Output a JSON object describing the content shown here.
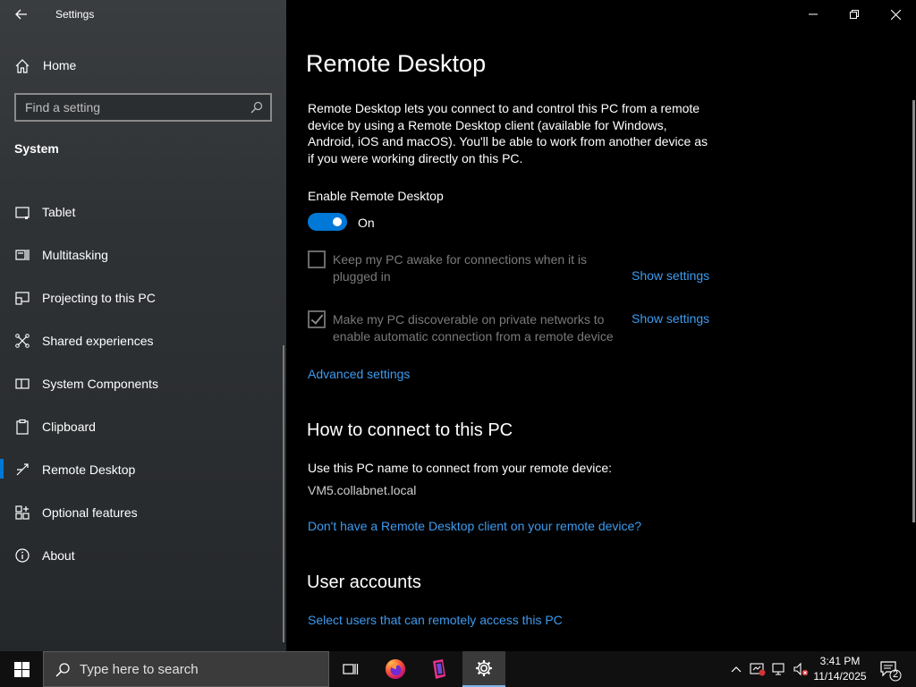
{
  "window": {
    "app_title": "Settings"
  },
  "sidebar": {
    "home_label": "Home",
    "search_placeholder": "Find a setting",
    "section_title": "System",
    "items": [
      {
        "label": "Tablet",
        "icon": "tablet-icon"
      },
      {
        "label": "Multitasking",
        "icon": "multitasking-icon"
      },
      {
        "label": "Projecting to this PC",
        "icon": "projecting-icon"
      },
      {
        "label": "Shared experiences",
        "icon": "shared-experiences-icon"
      },
      {
        "label": "System Components",
        "icon": "system-components-icon"
      },
      {
        "label": "Clipboard",
        "icon": "clipboard-icon"
      },
      {
        "label": "Remote Desktop",
        "icon": "remote-desktop-icon",
        "selected": true
      },
      {
        "label": "Optional features",
        "icon": "optional-features-icon"
      },
      {
        "label": "About",
        "icon": "info-icon"
      }
    ]
  },
  "main": {
    "title": "Remote Desktop",
    "description": "Remote Desktop lets you connect to and control this PC from a remote device by using a Remote Desktop client (available for Windows, Android, iOS and macOS). You'll be able to work from another device as if you were working directly on this PC.",
    "enable_label": "Enable Remote Desktop",
    "toggle_state": "On",
    "option_awake": {
      "text": "Keep my PC awake for connections when it is plugged in",
      "checked": false,
      "link": "Show settings"
    },
    "option_discoverable": {
      "text": "Make my PC discoverable on private networks to enable automatic connection from a remote device",
      "checked": true,
      "link": "Show settings"
    },
    "advanced_settings": "Advanced settings",
    "how_to_connect": {
      "heading": "How to connect to this PC",
      "instruction": "Use this PC name to connect from your remote device:",
      "pc_name": "VM5.collabnet.local",
      "client_link": "Don't have a Remote Desktop client on your remote device?"
    },
    "user_accounts": {
      "heading": "User accounts",
      "link": "Select users that can remotely access this PC"
    }
  },
  "taskbar": {
    "search_text": "Type here to search",
    "time": "3:41 PM",
    "date": "11/14/2025",
    "notification_count": "2"
  },
  "colors": {
    "accent": "#0078d7",
    "link": "#3d9bef"
  }
}
